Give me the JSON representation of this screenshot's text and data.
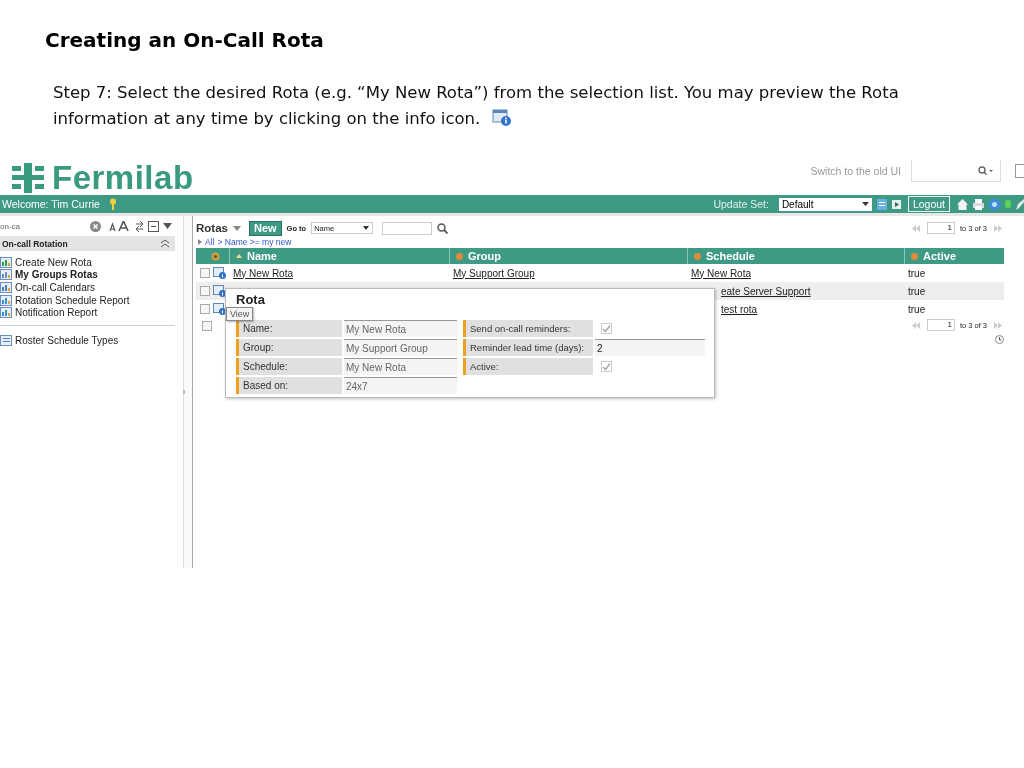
{
  "slide": {
    "title": "Creating an On-Call Rota",
    "step": "Step 7: Select the desired Rota (e.g. “My New Rota”) from the selection list. You may preview the Rota information at any time by clicking on the info icon."
  },
  "app": {
    "logo": "Fermilab",
    "switch_link": "Switch to the old UI",
    "welcome": "Welcome: Tim Currie",
    "update_set_label": "Update Set:",
    "update_set": "Default",
    "logout": "Logout"
  },
  "sidebar": {
    "filter": "on-ca",
    "section": "On-call Rotation",
    "items": [
      {
        "label": "Create New Rota",
        "selected": false
      },
      {
        "label": "My Groups Rotas",
        "selected": true
      },
      {
        "label": "On-call Calendars",
        "selected": false
      },
      {
        "label": "Rotation Schedule Report",
        "selected": false
      },
      {
        "label": "Notification Report",
        "selected": false
      }
    ],
    "extra_items": [
      {
        "label": "Roster Schedule Types",
        "selected": false
      }
    ]
  },
  "list": {
    "title": "Rotas",
    "new_button": "New",
    "goto_label": "Go to",
    "goto_field": "Name",
    "breadcrumb_all": "All",
    "breadcrumb_filter": "> Name >= my new",
    "pagers": [
      {
        "page": "1",
        "range": "to 3 of 3"
      },
      {
        "page": "1",
        "range": "to 3 of 3"
      }
    ],
    "columns": [
      "Name",
      "Group",
      "Schedule",
      "Active"
    ],
    "rows": [
      {
        "name": "My New Rota",
        "group": "My Support Group",
        "schedule": "My New Rota",
        "active": "true",
        "checked": false
      },
      {
        "schedule": "eate Server Support",
        "active": "true",
        "checked": false
      },
      {
        "schedule": "test rota",
        "active": "true",
        "checked": false
      }
    ],
    "select_all_checked": false
  },
  "popup": {
    "title": "Rota",
    "tooltip": "View",
    "left": [
      {
        "label": "Name:",
        "value": "My New Rota"
      },
      {
        "label": "Group:",
        "value": "My Support Group"
      },
      {
        "label": "Schedule:",
        "value": "My New Rota"
      },
      {
        "label": "Based on:",
        "value": "24x7"
      }
    ],
    "right": [
      {
        "label": "Send on-call reminders:",
        "kind": "checkbox",
        "checked": true
      },
      {
        "label": "Reminder lead time (days):",
        "kind": "text",
        "value": "2"
      },
      {
        "label": "Active:",
        "kind": "checkbox",
        "checked": true
      }
    ]
  }
}
